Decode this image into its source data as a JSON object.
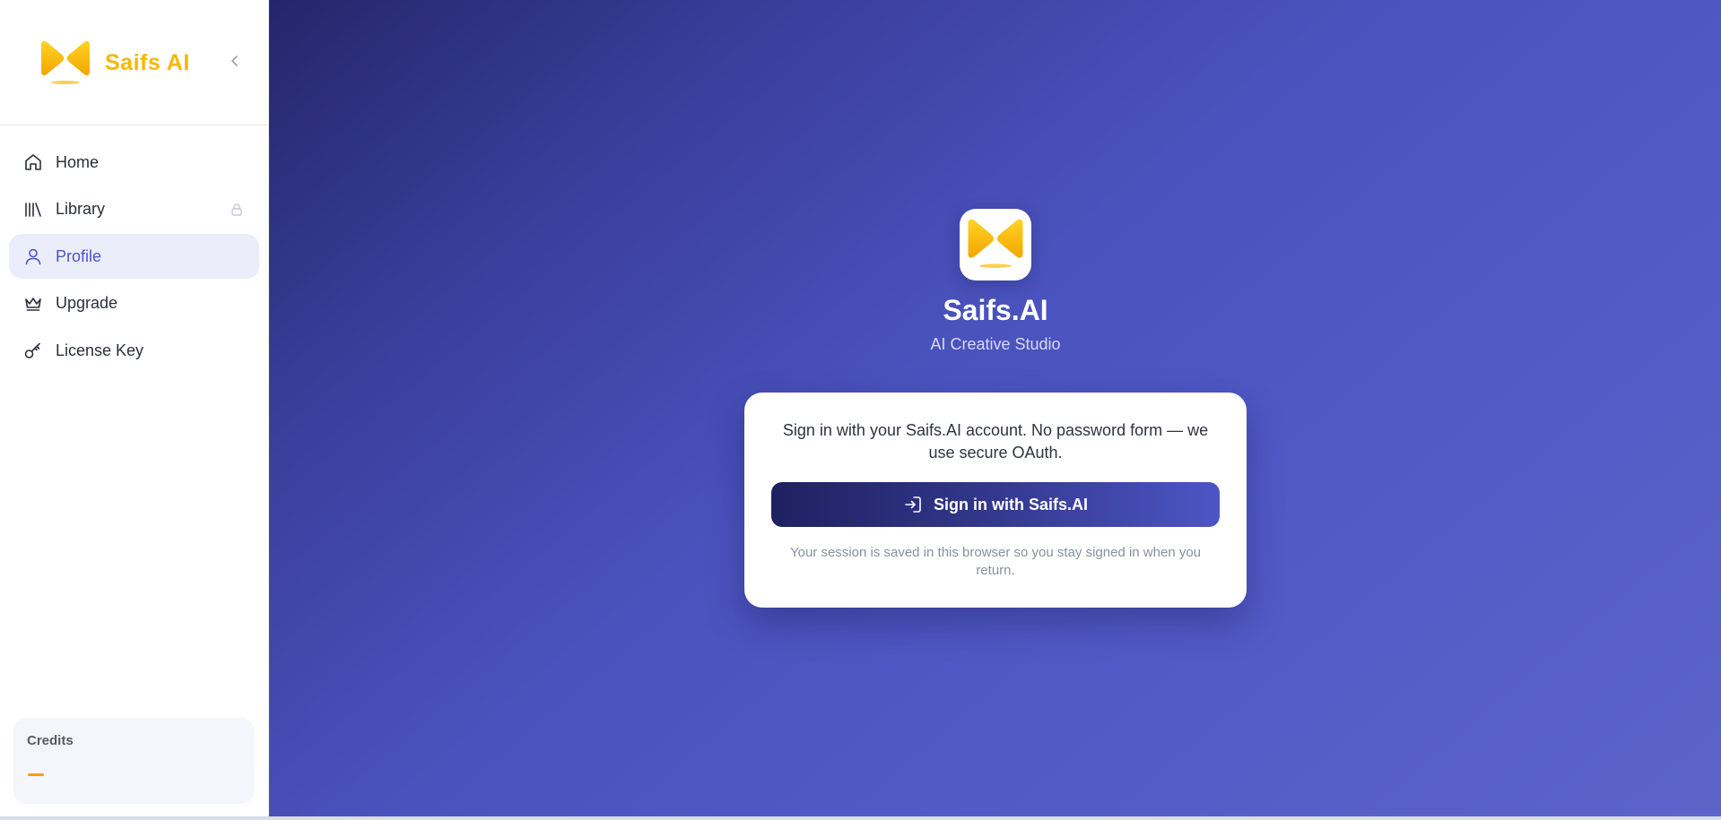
{
  "sidebar": {
    "brand_name": "Saifs AI",
    "collapse_icon": "chevron-left-icon",
    "nav": {
      "home": "Home",
      "library": "Library",
      "profile": "Profile",
      "upgrade": "Upgrade",
      "license": "License Key"
    },
    "active_item": "Profile",
    "credits": {
      "title": "Credits",
      "value": "—"
    }
  },
  "main": {
    "app_title": "Saifs.AI",
    "app_subtitle": "AI Creative Studio",
    "card": {
      "description": "Sign in with your Saifs.AI account. No password form — we use secure OAuth.",
      "button_label": "Sign in with Saifs.AI",
      "note": "Your session is saved in this browser so you stay signed in when you return."
    }
  },
  "colors": {
    "brand_yellow": "#f5b800",
    "accent": "#4b55c2",
    "active_bg": "#ecedfb",
    "credits_bar": "#f59b1a"
  }
}
